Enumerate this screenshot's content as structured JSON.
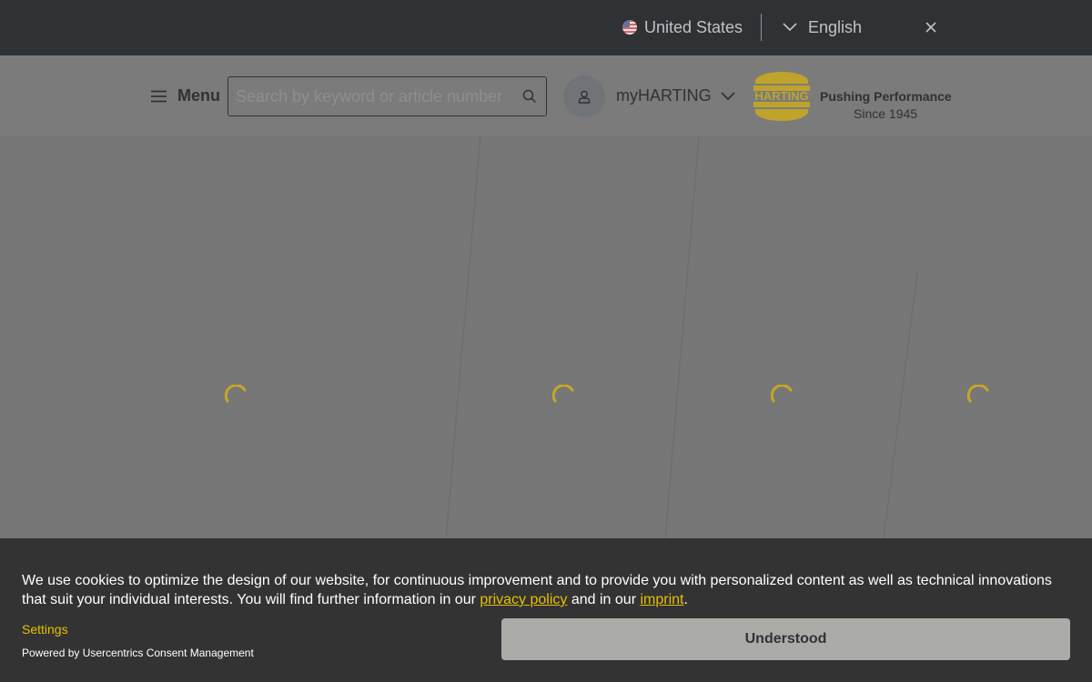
{
  "topbar": {
    "country_label": "United States",
    "language_label": "English",
    "close_icon": "close-icon"
  },
  "header": {
    "menu_label": "Menu",
    "search_placeholder": "Search by keyword or article number",
    "account_label": "myHARTING",
    "logo_text": "HARTING",
    "tagline": "Pushing Performance",
    "since": "Since 1945"
  },
  "content": {
    "loading_spinners": 4,
    "spinner_icon": "loading-spinner-icon"
  },
  "cookie_banner": {
    "text_before": "We use cookies to optimize the design of our website, for continuous improvement and to provide you with personalized content as well as technical innovations that suit your individual interests. You will find further information in our ",
    "privacy_link": "privacy policy",
    "text_middle": " and in our ",
    "imprint_link": "imprint",
    "text_after": ".",
    "settings_label": "Settings",
    "powered_by": "Powered by Usercentrics Consent Management",
    "accept_button": "Understood"
  },
  "colors": {
    "topbar_bg": "#2f3235",
    "overlay_bg": "#777777",
    "accent_yellow": "#e6c000",
    "banner_bg": "#333333",
    "button_bg": "#ababa8"
  }
}
